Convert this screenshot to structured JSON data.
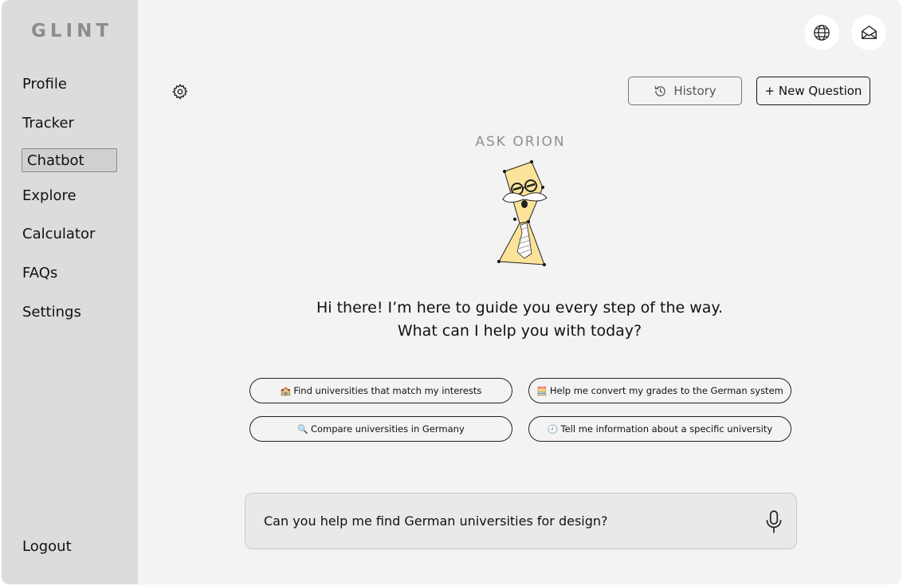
{
  "app": {
    "logo": "GLINT"
  },
  "sidebar": {
    "items": [
      {
        "label": "Profile"
      },
      {
        "label": "Tracker"
      },
      {
        "label": "Chatbot",
        "active": true
      },
      {
        "label": "Explore"
      },
      {
        "label": "Calculator"
      },
      {
        "label": "FAQs"
      },
      {
        "label": "Settings"
      }
    ],
    "logout_label": "Logout"
  },
  "header": {
    "icons": [
      "globe-icon",
      "mail-icon",
      "gear-icon"
    ],
    "history_label": "History",
    "new_question_label": "+ New Question"
  },
  "main": {
    "title": "ASK ORION",
    "mascot_icon": "orion-mascot",
    "greeting_line1": "Hi there! I’m here to guide you every step of the way.",
    "greeting_line2": "What can I help you with today?",
    "suggestions": [
      {
        "emoji": "🏫",
        "label": "Find universities that match my interests"
      },
      {
        "emoji": "🧮",
        "label": "Help me convert my grades to the German system"
      },
      {
        "emoji": "🔍",
        "label": "Compare universities in Germany"
      },
      {
        "emoji": "🕘",
        "label": "Tell me information about a specific university"
      }
    ]
  },
  "input": {
    "value": "Can you help me find German universities for design?",
    "icon": "microphone-icon"
  },
  "colors": {
    "background": "#f3f3f3",
    "sidebar": "#dcdcdc",
    "logo": "#8c8c8c",
    "mascot_yellow": "#fbe49a"
  }
}
